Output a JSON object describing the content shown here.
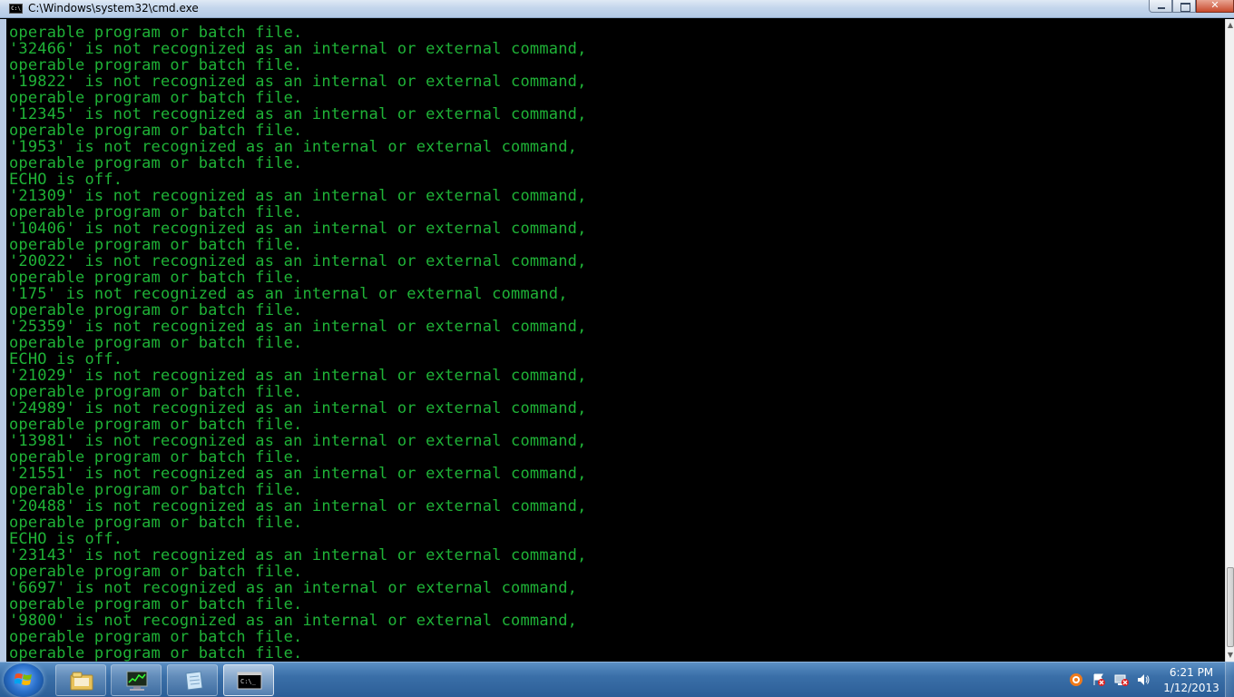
{
  "window": {
    "title": "C:\\Windows\\system32\\cmd.exe",
    "icon_label": "C:\\"
  },
  "console": {
    "lines": [
      "operable program or batch file.",
      "'32466' is not recognized as an internal or external command,",
      "operable program or batch file.",
      "'19822' is not recognized as an internal or external command,",
      "operable program or batch file.",
      "'12345' is not recognized as an internal or external command,",
      "operable program or batch file.",
      "'1953' is not recognized as an internal or external command,",
      "operable program or batch file.",
      "ECHO is off.",
      "'21309' is not recognized as an internal or external command,",
      "operable program or batch file.",
      "'10406' is not recognized as an internal or external command,",
      "operable program or batch file.",
      "'20022' is not recognized as an internal or external command,",
      "operable program or batch file.",
      "'175' is not recognized as an internal or external command,",
      "operable program or batch file.",
      "'25359' is not recognized as an internal or external command,",
      "operable program or batch file.",
      "ECHO is off.",
      "'21029' is not recognized as an internal or external command,",
      "operable program or batch file.",
      "'24989' is not recognized as an internal or external command,",
      "operable program or batch file.",
      "'13981' is not recognized as an internal or external command,",
      "operable program or batch file.",
      "'21551' is not recognized as an internal or external command,",
      "operable program or batch file.",
      "'20488' is not recognized as an internal or external command,",
      "operable program or batch file.",
      "ECHO is off.",
      "'23143' is not recognized as an internal or external command,",
      "operable program or batch file.",
      "'6697' is not recognized as an internal or external command,",
      "operable program or batch file.",
      "'9800' is not recognized as an internal or external command,",
      "operable program or batch file.",
      "operable program or batch file."
    ],
    "text_color": "#1fb337",
    "background_color": "#000000"
  },
  "taskbar": {
    "buttons": [
      {
        "name": "windows-explorer",
        "icon": "folder-icon"
      },
      {
        "name": "task-manager",
        "icon": "task-manager-icon"
      },
      {
        "name": "notepad",
        "icon": "notepad-icon"
      },
      {
        "name": "command-prompt",
        "icon": "cmd-icon",
        "active": true
      }
    ],
    "cmd_icon_label": "C:\\_",
    "tray_icons": [
      "antivirus-icon",
      "action-center-icon",
      "network-icon",
      "volume-icon"
    ],
    "clock": {
      "time": "6:21 PM",
      "date": "1/12/2013"
    }
  }
}
